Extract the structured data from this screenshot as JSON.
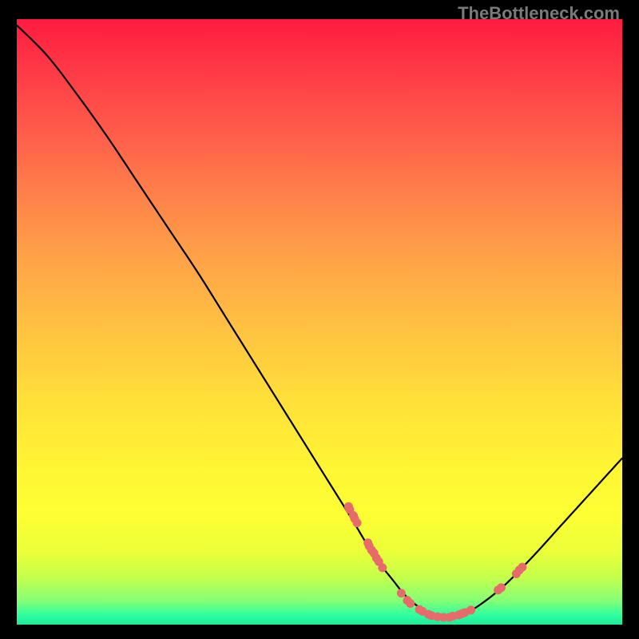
{
  "watermark": "TheBottleneck.com",
  "chart_data": {
    "type": "line",
    "title": "",
    "xlabel": "",
    "ylabel": "",
    "xlim": [
      0,
      100
    ],
    "ylim": [
      0,
      100
    ],
    "curve": {
      "name": "bottleneck-curve",
      "x": [
        0,
        5,
        10,
        15,
        20,
        25,
        30,
        35,
        40,
        45,
        50,
        55,
        58,
        60,
        62,
        64,
        66,
        68,
        70,
        72,
        75,
        80,
        85,
        90,
        95,
        100
      ],
      "y": [
        99,
        94,
        87.5,
        80.5,
        73,
        65.5,
        58,
        50,
        42,
        34,
        26,
        18,
        13,
        10,
        7.5,
        5,
        3.2,
        2,
        1.3,
        1.3,
        2.3,
        6,
        11,
        16.5,
        22,
        27.5
      ]
    },
    "markers": {
      "name": "highlighted-points",
      "color": "#e86b6b",
      "radius": 5.5,
      "points": [
        {
          "x": 54.8,
          "y": 19.5
        },
        {
          "x": 55.0,
          "y": 19.0
        },
        {
          "x": 55.6,
          "y": 18.0
        },
        {
          "x": 55.8,
          "y": 17.5
        },
        {
          "x": 56.2,
          "y": 16.8
        },
        {
          "x": 58.0,
          "y": 13.5
        },
        {
          "x": 58.2,
          "y": 13.0
        },
        {
          "x": 58.6,
          "y": 12.3
        },
        {
          "x": 59.0,
          "y": 11.8
        },
        {
          "x": 59.4,
          "y": 11.0
        },
        {
          "x": 59.8,
          "y": 10.4
        },
        {
          "x": 60.4,
          "y": 9.4
        },
        {
          "x": 63.5,
          "y": 5.2
        },
        {
          "x": 64.5,
          "y": 4.0
        },
        {
          "x": 65.0,
          "y": 3.5
        },
        {
          "x": 66.5,
          "y": 2.5
        },
        {
          "x": 67.0,
          "y": 2.2
        },
        {
          "x": 68.0,
          "y": 1.7
        },
        {
          "x": 68.5,
          "y": 1.5
        },
        {
          "x": 69.5,
          "y": 1.3
        },
        {
          "x": 70.5,
          "y": 1.2
        },
        {
          "x": 71.5,
          "y": 1.2
        },
        {
          "x": 72.0,
          "y": 1.4
        },
        {
          "x": 73.0,
          "y": 1.6
        },
        {
          "x": 73.5,
          "y": 1.8
        },
        {
          "x": 74.0,
          "y": 2.0
        },
        {
          "x": 75.0,
          "y": 2.4
        },
        {
          "x": 79.5,
          "y": 5.7
        },
        {
          "x": 80.0,
          "y": 6.1
        },
        {
          "x": 82.5,
          "y": 8.4
        },
        {
          "x": 83.0,
          "y": 9.0
        },
        {
          "x": 83.5,
          "y": 9.5
        }
      ]
    }
  }
}
